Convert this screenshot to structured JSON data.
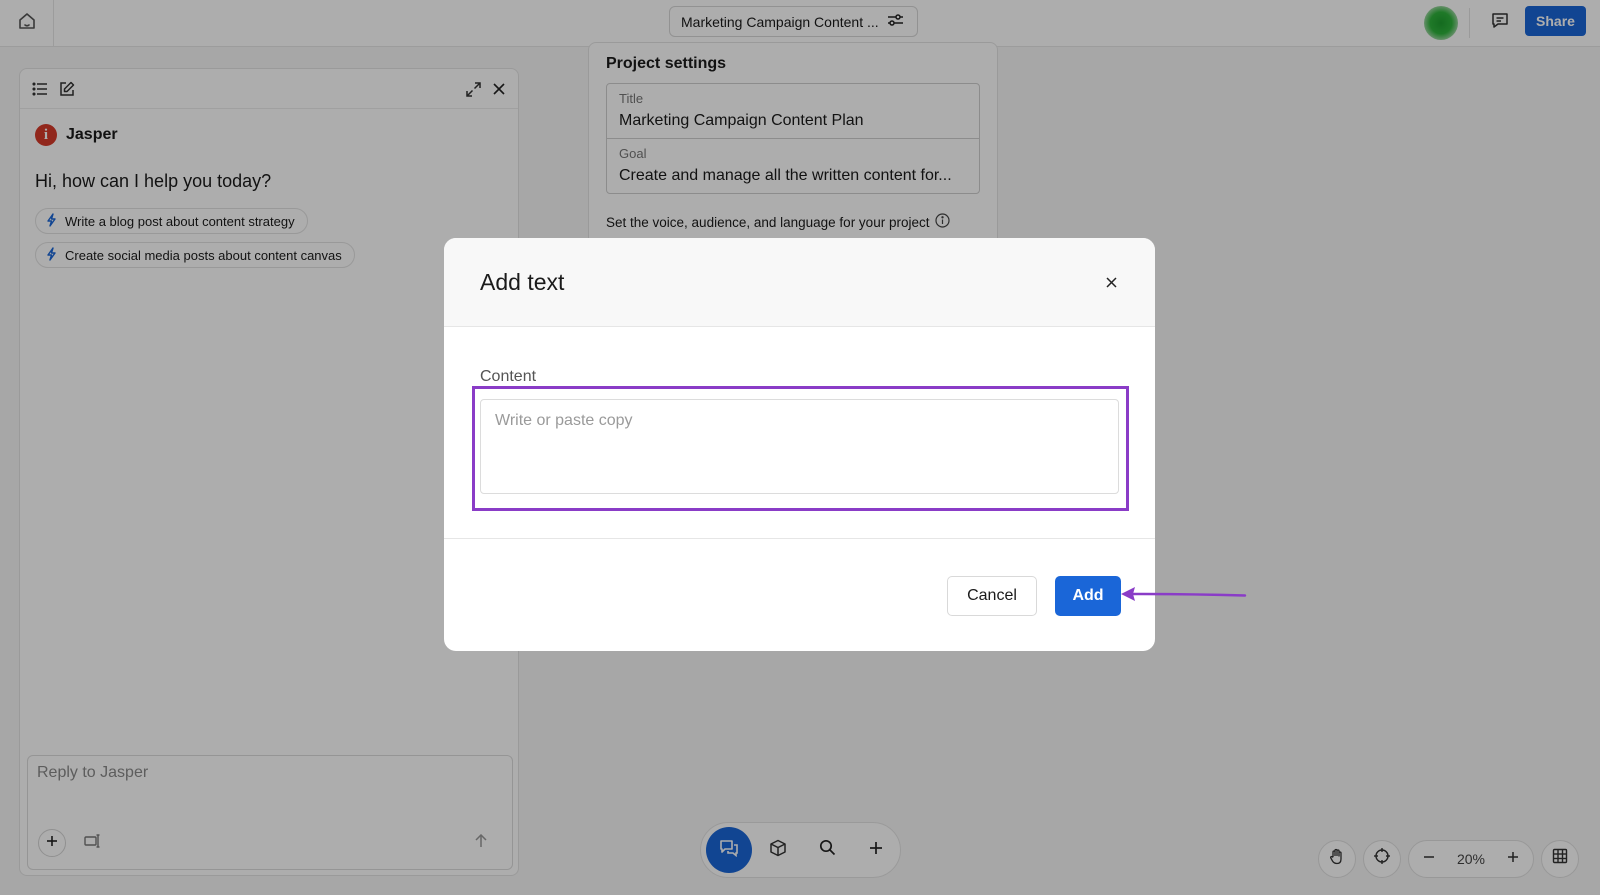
{
  "topbar": {
    "project_title": "Marketing Campaign Content ...",
    "share_label": "Share"
  },
  "assistant": {
    "name": "Jasper",
    "logo_letter": "i",
    "greeting": "Hi, how can I help you today?",
    "suggestions": [
      "Write a blog post about content strategy",
      "Create social media posts about content canvas"
    ],
    "reply_placeholder": "Reply to Jasper"
  },
  "settings": {
    "heading": "Project settings",
    "title_label": "Title",
    "title_value": "Marketing Campaign Content Plan",
    "goal_label": "Goal",
    "goal_value": "Create and manage all the written content for...",
    "voice_hint": "Set the voice, audience, and language for your project"
  },
  "zoom": {
    "level": "20%"
  },
  "modal": {
    "title": "Add text",
    "content_label": "Content",
    "content_placeholder": "Write or paste copy",
    "cancel_label": "Cancel",
    "add_label": "Add"
  },
  "colors": {
    "accent": "#1a66d8",
    "annotation": "#8a3cc7",
    "jasper_red": "#d63a2a"
  }
}
